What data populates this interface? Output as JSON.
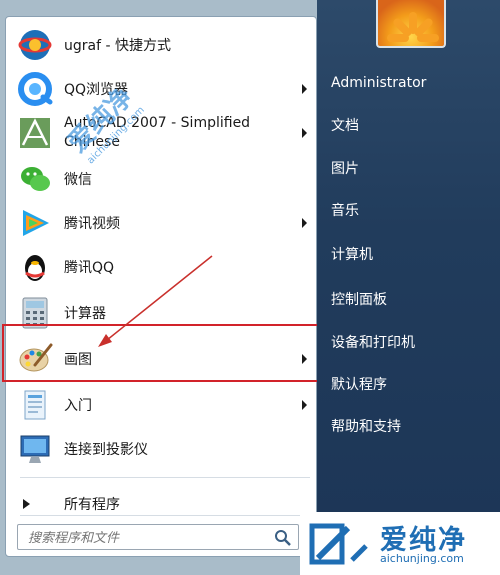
{
  "start_menu": {
    "programs": [
      {
        "label": "ugraf - 快捷方式",
        "icon": "ugraf-icon",
        "has_submenu": false
      },
      {
        "label": "QQ浏览器",
        "icon": "qq-browser-icon",
        "has_submenu": true
      },
      {
        "label": "AutoCAD 2007 - Simplified Chinese",
        "icon": "autocad-icon",
        "has_submenu": true
      },
      {
        "label": "微信",
        "icon": "wechat-icon",
        "has_submenu": false
      },
      {
        "label": "腾讯视频",
        "icon": "tencent-video-icon",
        "has_submenu": true
      },
      {
        "label": "腾讯QQ",
        "icon": "qq-penguin-icon",
        "has_submenu": false
      },
      {
        "label": "计算器",
        "icon": "calculator-icon",
        "has_submenu": false
      },
      {
        "label": "画图",
        "icon": "paint-icon",
        "has_submenu": true,
        "highlighted": true
      },
      {
        "label": "入门",
        "icon": "getting-started-icon",
        "has_submenu": true
      },
      {
        "label": "连接到投影仪",
        "icon": "projector-icon",
        "has_submenu": false
      }
    ],
    "all_programs": "所有程序",
    "search_placeholder": "搜索程序和文件"
  },
  "right_panel": {
    "items": [
      "Administrator",
      "文档",
      "图片",
      "音乐",
      "计算机",
      "控制面板",
      "设备和打印机",
      "默认程序",
      "帮助和支持"
    ]
  },
  "watermark": {
    "brand": "爱纯净",
    "domain": "aichunjing.com",
    "diag_text": "爱纯净",
    "diag_domain": "aichunjing.com"
  },
  "colors": {
    "highlight_border": "#d2232a",
    "right_panel_bg": "#213c5c",
    "watermark_blue": "#1f6eb4"
  }
}
